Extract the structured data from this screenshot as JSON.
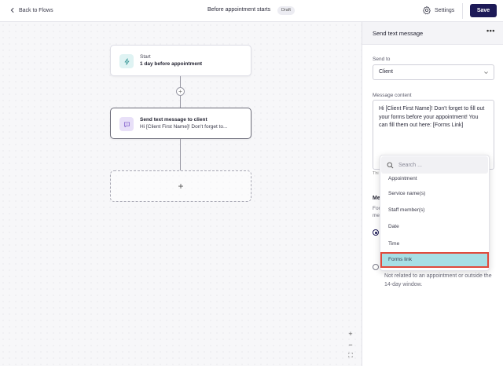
{
  "topbar": {
    "back_label": "Back to Flows",
    "flow_title": "Before appointment starts",
    "status_badge": "Draft",
    "settings_label": "Settings",
    "save_label": "Save"
  },
  "canvas": {
    "start_node": {
      "label": "Start",
      "subtitle": "1 day before appointment"
    },
    "send_node": {
      "label": "Send text message to client",
      "subtitle": "Hi [Client First Name]! Don't forget to..."
    },
    "add_step_symbol": "+",
    "insert_symbol": "+",
    "zoom_in": "+",
    "zoom_out": "−",
    "fit": "⛶"
  },
  "panel": {
    "title": "Send text message",
    "more": "•••",
    "send_to_label": "Send to",
    "send_to_value": "Client",
    "message_label": "Message content",
    "message_value": "Hi [Client First Name]! Don't forget to fill out your forms before your appointment! You can fill them out here: [Forms Link]",
    "hint_fragment": "Thi",
    "section_heading_fragment": "Me",
    "section_text_line1": "For",
    "section_text_line2": "me",
    "radio_desc": "Not related to an appointment or outside the 14-day window."
  },
  "dropdown": {
    "search_placeholder": "Search ...",
    "items": [
      "Appointment",
      "Service name(s)",
      "Staff member(s)",
      "Date",
      "Time",
      "Forms link"
    ],
    "selected_index": 5
  },
  "colors": {
    "primary": "#1d1a57",
    "selected_item_bg": "#a7dfe5",
    "highlight_border": "#e04a3c"
  }
}
